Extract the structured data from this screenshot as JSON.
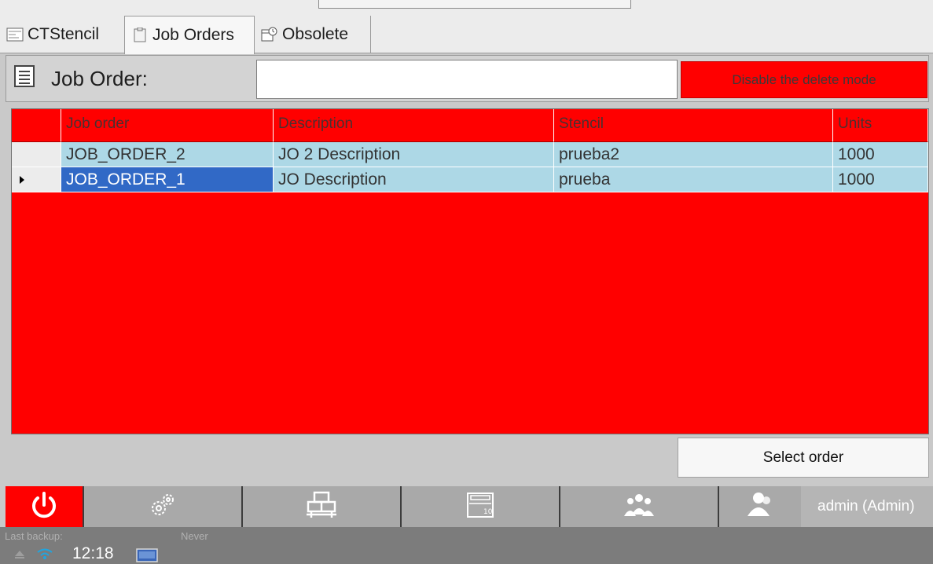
{
  "tabs": [
    {
      "label": "CTStencil",
      "icon": "stencil-icon",
      "active": false
    },
    {
      "label": "Job Orders",
      "icon": "clipboard-icon",
      "active": true
    },
    {
      "label": "Obsolete",
      "icon": "calendar-icon",
      "active": false
    }
  ],
  "job_order": {
    "label": "Job Order:",
    "input_value": "",
    "delete_button": "Disable the delete mode"
  },
  "table": {
    "columns": [
      "Job order",
      "Description",
      "Stencil",
      "Units"
    ],
    "rows": [
      {
        "job_order": "JOB_ORDER_2",
        "description": "JO 2 Description",
        "stencil": "prueba2",
        "units": "1000",
        "selected": false
      },
      {
        "job_order": "JOB_ORDER_1",
        "description": "JO Description",
        "stencil": "prueba",
        "units": "1000",
        "selected": true
      }
    ]
  },
  "select_button": "Select order",
  "nav": {
    "items": [
      "power-icon",
      "gears-icon",
      "pallet-icon",
      "stencil-frame-icon",
      "users-group-icon",
      "user-icon"
    ],
    "user_label": "admin (Admin)"
  },
  "status": {
    "backup_label": "Last backup:",
    "backup_value": "Never",
    "time": "12:18"
  },
  "colors": {
    "grid_red": "#ff0000",
    "row_blue": "#add8e6",
    "selected_blue": "#3169c6"
  }
}
